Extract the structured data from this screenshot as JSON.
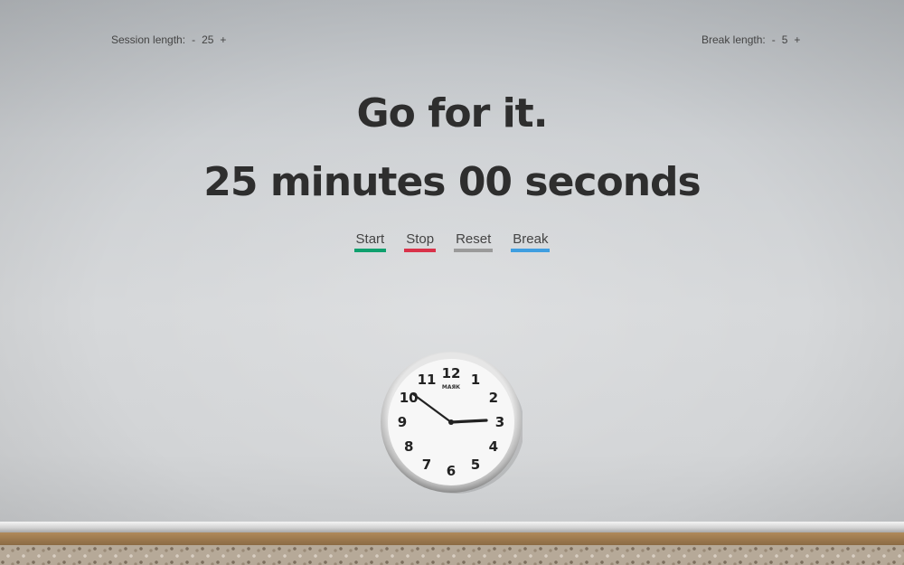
{
  "session": {
    "label": "Session length:",
    "minus": "-",
    "value": "25",
    "plus": "+"
  },
  "break_setting": {
    "label": "Break length:",
    "minus": "-",
    "value": "5",
    "plus": "+"
  },
  "motto": "Go for it.",
  "timer": {
    "minutes": "25",
    "minutes_label": "minutes",
    "seconds": "00",
    "seconds_label": "seconds"
  },
  "controls": {
    "start": "Start",
    "stop": "Stop",
    "reset": "Reset",
    "break": "Break"
  },
  "colors": {
    "start": "#0fa06e",
    "stop": "#d9324a",
    "reset": "#9a9a9a",
    "break": "#3f9ee0"
  },
  "clock": {
    "numerals": [
      "12",
      "1",
      "2",
      "3",
      "4",
      "5",
      "6",
      "7",
      "8",
      "9",
      "10",
      "11"
    ],
    "brand": "МАЯК",
    "time_shown": "2:50"
  }
}
